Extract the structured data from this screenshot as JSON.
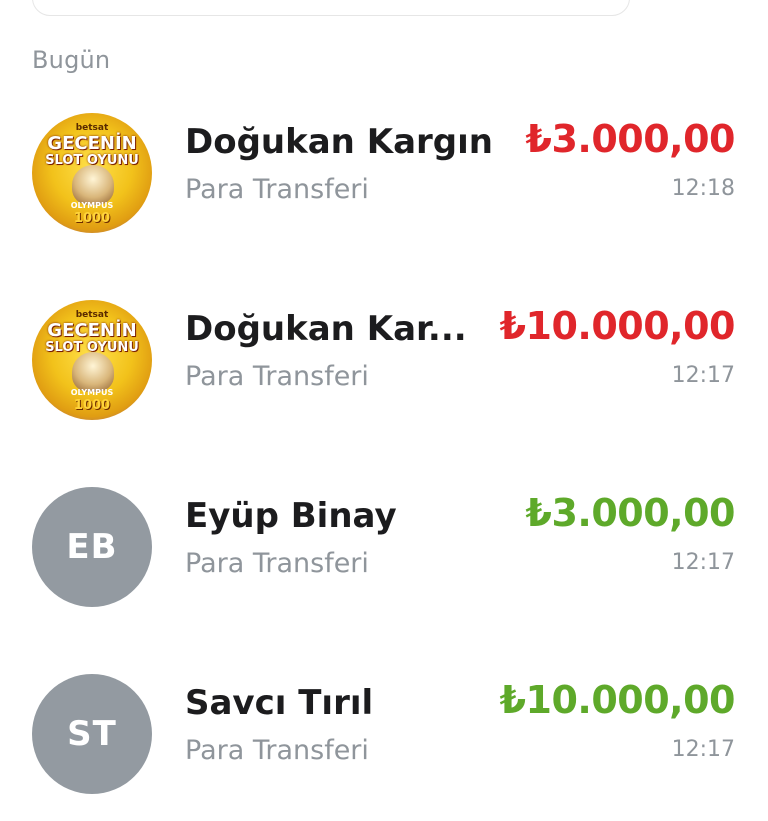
{
  "section": {
    "label": "Bugün"
  },
  "colors": {
    "debit": "#e0262b",
    "credit": "#5ea92a"
  },
  "promo_avatar": {
    "brand": "betsat",
    "line1": "GECENİN",
    "line2": "SLOT OYUNU",
    "game": "OLYMPUS",
    "number": "1000"
  },
  "transactions": [
    {
      "name": "Doğukan Kargın",
      "subtitle": "Para Transferi",
      "amount": "₺3.000,00",
      "time": "12:18",
      "direction": "debit",
      "avatar": "promo"
    },
    {
      "name": "Doğukan Kar...",
      "subtitle": "Para Transferi",
      "amount": "₺10.000,00",
      "time": "12:17",
      "direction": "debit",
      "avatar": "promo"
    },
    {
      "name": "Eyüp Binay",
      "subtitle": "Para Transferi",
      "amount": "₺3.000,00",
      "time": "12:17",
      "direction": "credit",
      "avatar": "initials",
      "initials": "EB"
    },
    {
      "name": "Savcı Tırıl",
      "subtitle": "Para Transferi",
      "amount": "₺10.000,00",
      "time": "12:17",
      "direction": "credit",
      "avatar": "initials",
      "initials": "ST"
    }
  ]
}
